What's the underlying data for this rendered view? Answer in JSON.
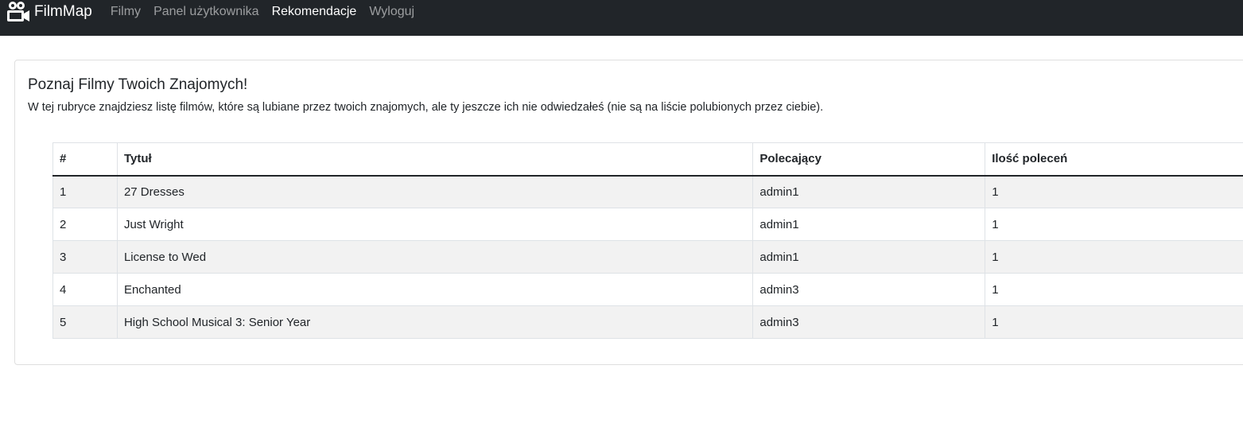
{
  "navbar": {
    "brand": "FilmMap",
    "links": [
      {
        "label": "Filmy",
        "active": false
      },
      {
        "label": "Panel użytkownika",
        "active": false
      },
      {
        "label": "Rekomendacje",
        "active": true
      },
      {
        "label": "Wyloguj",
        "active": false
      }
    ],
    "brand_icon": "video-camera-icon",
    "bg_color": "#212529"
  },
  "card": {
    "title": "Poznaj Filmy Twoich Znajomych!",
    "description": "W tej rubryce znajdziesz listę filmów, które są lubiane przez twoich znajomych, ale ty jeszcze ich nie odwiedzałeś (nie są na liście polubionych przez ciebie)."
  },
  "table": {
    "headers": [
      "#",
      "Tytuł",
      "Polecający",
      "Ilość poleceń"
    ],
    "rows": [
      [
        "1",
        "27 Dresses",
        "admin1",
        "1"
      ],
      [
        "2",
        "Just Wright",
        "admin1",
        "1"
      ],
      [
        "3",
        "License to Wed",
        "admin1",
        "1"
      ],
      [
        "4",
        "Enchanted",
        "admin3",
        "1"
      ],
      [
        "5",
        "High School Musical 3: Senior Year",
        "admin3",
        "1"
      ]
    ]
  }
}
